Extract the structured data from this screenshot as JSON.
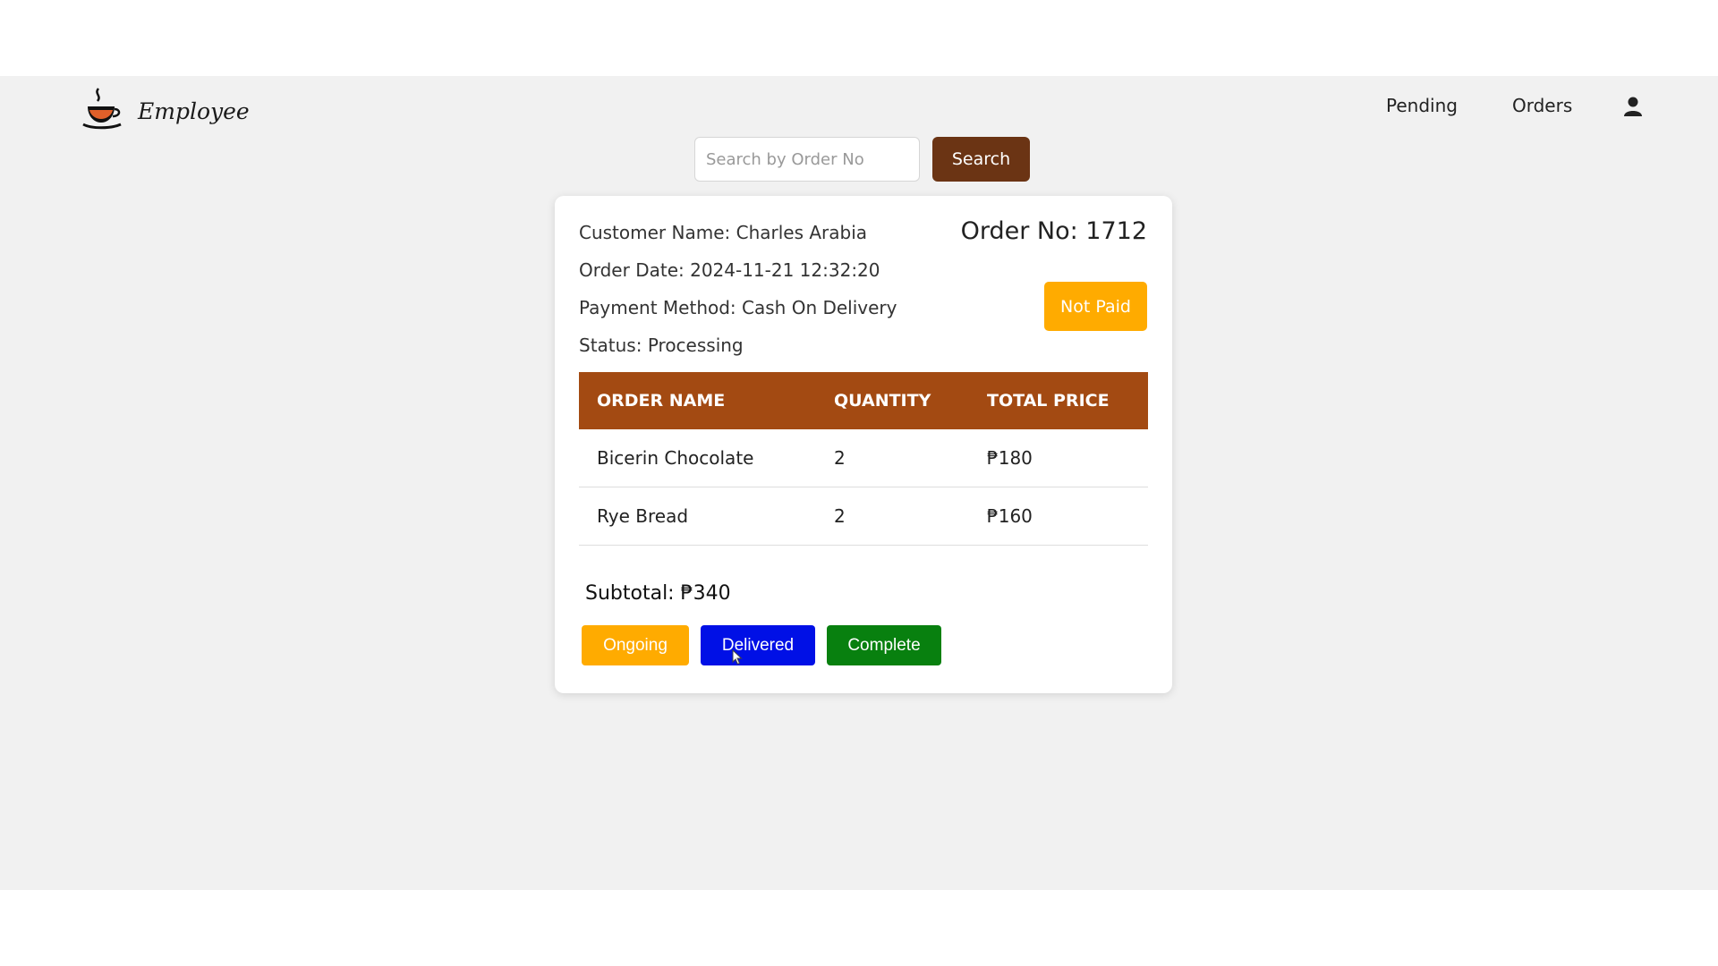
{
  "app": {
    "brand_name": "Employee",
    "icons": {
      "logo": "coffee-cup-logo-icon",
      "user": "user-icon"
    },
    "colors": {
      "background": "#f1f1f1",
      "search_button": "#6b3414",
      "table_header": "#a34a12",
      "not_paid_badge": "#ffab00",
      "ongoing": "#ffab00",
      "delivered": "#0010e6",
      "complete": "#08800f"
    }
  },
  "nav": {
    "pending": "Pending",
    "orders": "Orders"
  },
  "search": {
    "placeholder": "Search by Order No",
    "value": "",
    "button": "Search"
  },
  "order": {
    "customer_name": "Customer Name: Charles Arabia",
    "order_date": "Order Date: 2024-11-21 12:32:20",
    "payment_method": "Payment Method: Cash On Delivery",
    "status": "Status: Processing",
    "order_no": "Order No: 1712",
    "payment_status": "Not Paid",
    "table": {
      "headers": [
        "ORDER NAME",
        "QUANTITY",
        "TOTAL PRICE"
      ],
      "rows": [
        [
          "Bicerin Chocolate",
          "2",
          "₱180"
        ],
        [
          "Rye Bread",
          "2",
          "₱160"
        ]
      ]
    },
    "subtotal": "Subtotal: ₱340",
    "actions": {
      "ongoing": "Ongoing",
      "delivered": "Delivered",
      "complete": "Complete"
    }
  }
}
